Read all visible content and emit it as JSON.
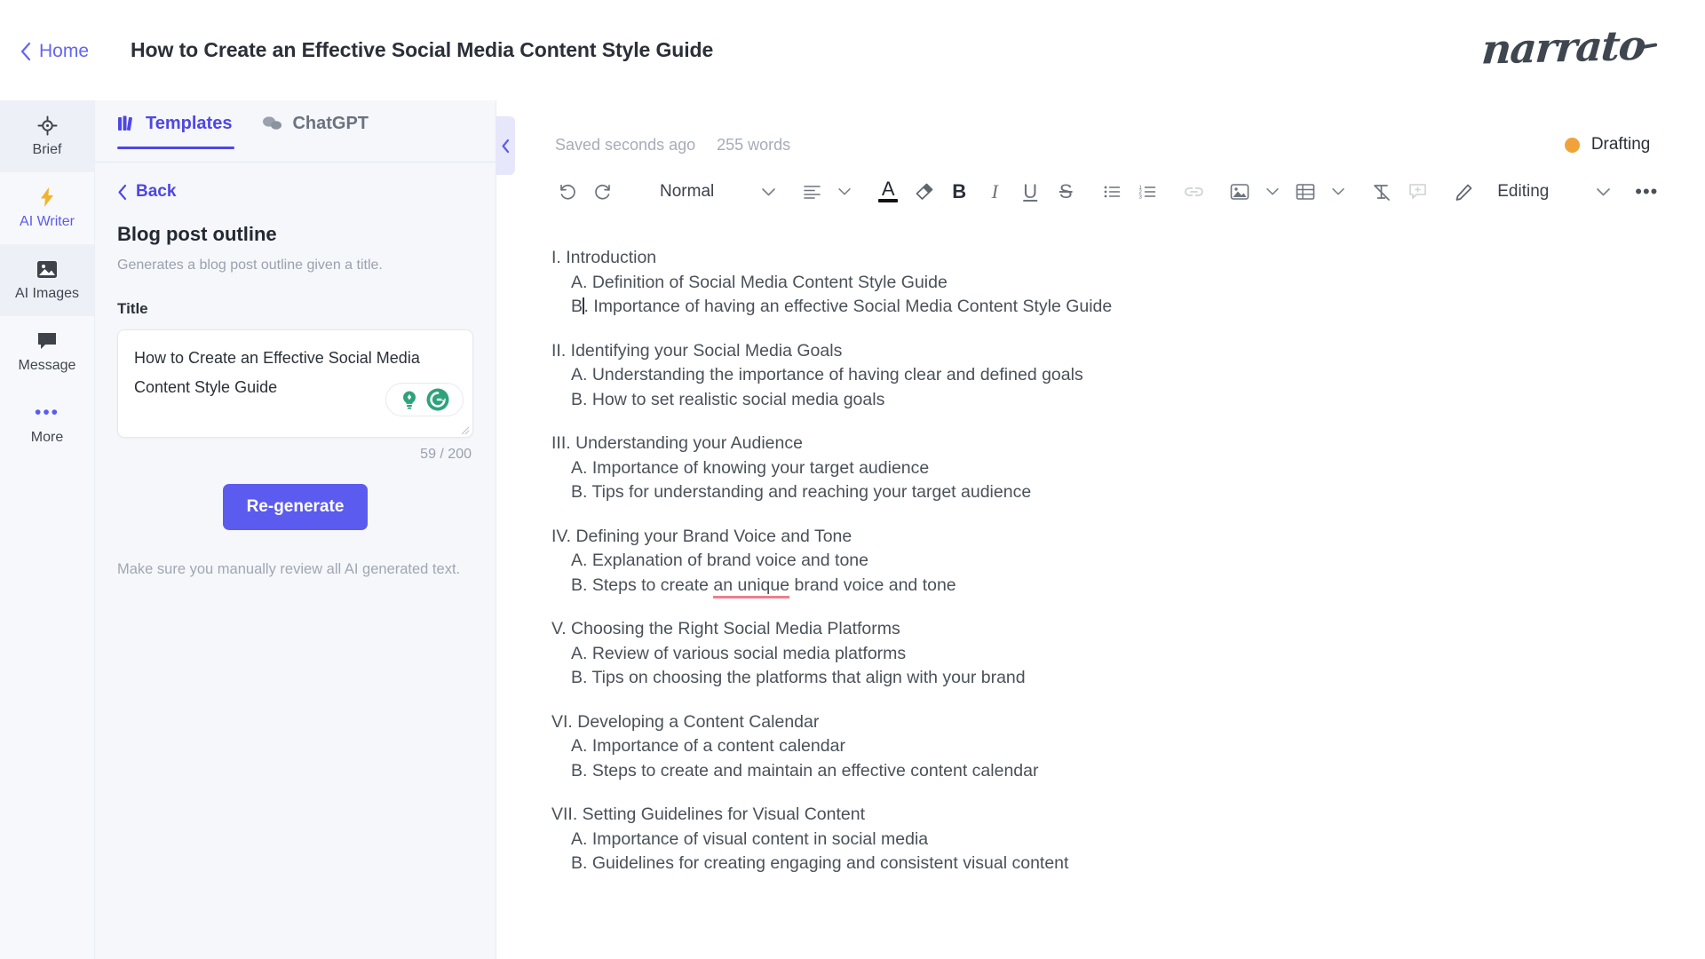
{
  "topbar": {
    "home_label": "Home",
    "home_icon": "chevron-left-icon",
    "doc_title": "How to Create an Effective Social Media Content Style Guide",
    "logo_text": "narrato"
  },
  "rail": {
    "items": [
      {
        "label": "Brief",
        "icon": "target-icon",
        "active": false
      },
      {
        "label": "AI Writer",
        "icon": "lightning-bolt-icon",
        "active": true
      },
      {
        "label": "AI Images",
        "icon": "image-icon",
        "active": false
      },
      {
        "label": "Message",
        "icon": "chat-bubble-icon",
        "active": false
      },
      {
        "label": "More",
        "icon": "ellipsis-icon",
        "active": false
      }
    ]
  },
  "panel": {
    "tabs": [
      {
        "label": "Templates",
        "icon": "templates-grid-icon",
        "active": true
      },
      {
        "label": "ChatGPT",
        "icon": "chat-bubbles-icon",
        "active": false
      }
    ],
    "back_label": "Back",
    "back_icon": "chevron-left-icon",
    "template_title": "Blog post outline",
    "template_desc": "Generates a blog post outline given a title.",
    "field_label": "Title",
    "field_value": "How to Create an Effective Social Media Content Style Guide",
    "char_count": "59 / 200",
    "ai_icons": [
      "lightbulb-icon",
      "grammarly-refresh-icon"
    ],
    "regenerate_label": "Re-generate",
    "disclaimer": "Make sure you manually review all AI generated text.",
    "collapse_icon": "chevron-left-icon"
  },
  "editor": {
    "saved_status": "Saved seconds ago",
    "word_count": "255 words",
    "doc_state": "Drafting",
    "doc_state_color": "#f0a33a",
    "toolbar": {
      "undo_icon": "undo-icon",
      "redo_icon": "redo-icon",
      "block_style": "Normal",
      "block_style_chevron": "chevron-down-icon",
      "align_icon": "align-left-icon",
      "align_chevron": "chevron-down-icon",
      "font_color_icon": "font-color-A-icon",
      "highlight_icon": "highlighter-icon",
      "bold_icon": "bold-icon",
      "italic_icon": "italic-icon",
      "underline_icon": "underline-icon",
      "strikethrough_icon": "strikethrough-icon",
      "bullet_list_icon": "bullet-list-icon",
      "numbered_list_icon": "numbered-list-icon",
      "link_icon": "link-icon",
      "image_icon": "image-insert-icon",
      "image_chevron": "chevron-down-icon",
      "table_icon": "table-icon",
      "table_chevron": "chevron-down-icon",
      "clear_format_icon": "clear-formatting-icon",
      "comment_icon": "add-comment-icon",
      "mode_icon": "pencil-icon",
      "mode_label": "Editing",
      "mode_chevron": "chevron-down-icon",
      "more_icon": "ellipsis-icon"
    },
    "document": [
      {
        "heading": "I. Introduction",
        "items": [
          {
            "text": "A. Definition of Social Media Content Style Guide"
          },
          {
            "text_before": "B",
            "caret": true,
            "text_after": ". Importance of having an effective Social Media Content Style Guide"
          }
        ]
      },
      {
        "heading": "II. Identifying your Social Media Goals",
        "items": [
          {
            "text": "A. Understanding the importance of having clear and defined goals"
          },
          {
            "text": "B. How to set realistic social media goals"
          }
        ]
      },
      {
        "heading": "III. Understanding your Audience",
        "items": [
          {
            "text": "A. Importance of knowing your target audience"
          },
          {
            "text": "B. Tips for understanding and reaching your target audience"
          }
        ]
      },
      {
        "heading": "IV. Defining your Brand Voice and Tone",
        "items": [
          {
            "text": "A. Explanation of brand voice and tone"
          },
          {
            "text_before": "B. Steps to create ",
            "misspelled": "an unique",
            "text_after": " brand voice and tone"
          }
        ]
      },
      {
        "heading": "V. Choosing the Right Social Media Platforms",
        "items": [
          {
            "text": "A. Review of various social media platforms"
          },
          {
            "text": "B. Tips on choosing the platforms that align with your brand"
          }
        ]
      },
      {
        "heading": "VI. Developing a Content Calendar",
        "items": [
          {
            "text": "A. Importance of a content calendar"
          },
          {
            "text": "B. Steps to create and maintain an effective content calendar"
          }
        ]
      },
      {
        "heading": "VII. Setting Guidelines for Visual Content",
        "items": [
          {
            "text": "A. Importance of visual content in social media"
          },
          {
            "text": "B. Guidelines for creating engaging and consistent visual content"
          }
        ]
      }
    ]
  },
  "colors": {
    "accent": "#5b5bf0",
    "tab_accent": "#4f46e5",
    "panel_bg": "#f5f7fb",
    "rail_bg": "#f7f8fc",
    "status_orange": "#f0a33a",
    "ai_green": "#2ea37b",
    "misspell": "#f07d8e"
  }
}
